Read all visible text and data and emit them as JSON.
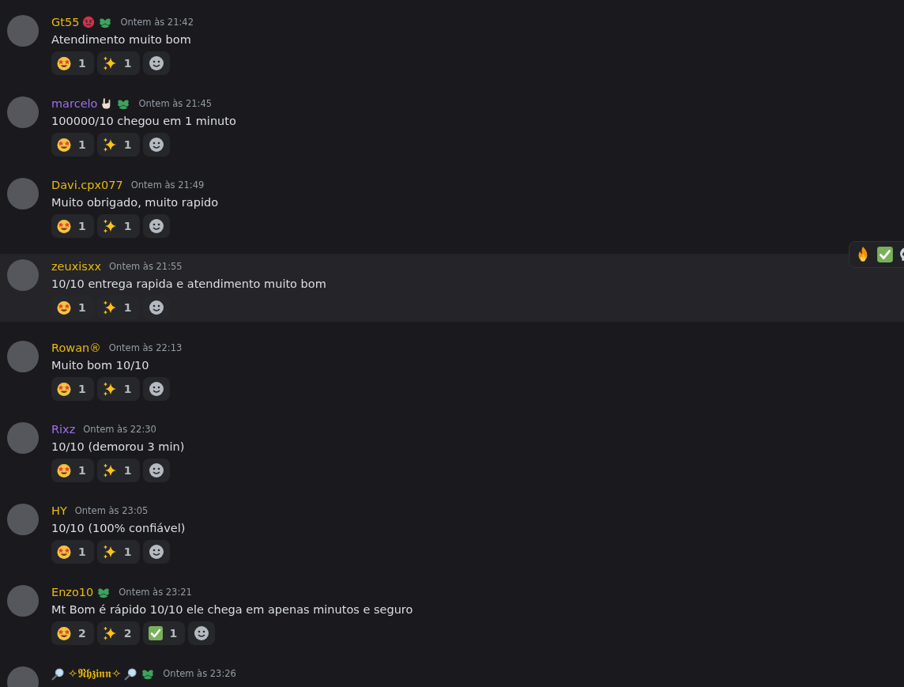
{
  "messages": [
    {
      "author": "Gt55",
      "color": "#e8b90c",
      "suffix_icons": [
        {
          "kind": "angry-face"
        },
        {
          "kind": "clover"
        }
      ],
      "time": "Ontem às 21:42",
      "text": "Atendimento muito bom",
      "highlighted": false,
      "reactions": [
        {
          "kind": "star-struck",
          "count": "1"
        },
        {
          "kind": "sparkles",
          "count": "1"
        }
      ]
    },
    {
      "author": "marcelo",
      "color": "#9f6ee8",
      "suffix_icons": [
        {
          "kind": "rock-hand"
        },
        {
          "kind": "clover"
        }
      ],
      "time": "Ontem às 21:45",
      "text": "100000/10 chegou em 1 minuto",
      "highlighted": false,
      "reactions": [
        {
          "kind": "star-struck",
          "count": "1"
        },
        {
          "kind": "sparkles",
          "count": "1"
        }
      ]
    },
    {
      "author": "Davi.cpx077",
      "color": "#e8b90c",
      "time": "Ontem às 21:49",
      "text": "Muito obrigado, muito rapido",
      "highlighted": false,
      "reactions": [
        {
          "kind": "star-struck",
          "count": "1"
        },
        {
          "kind": "sparkles",
          "count": "1"
        }
      ]
    },
    {
      "author": "zeuxisxx",
      "color": "#e8b90c",
      "time": "Ontem às 21:55",
      "text": "10/10 entrega rapida e atendimento muito bom",
      "highlighted": true,
      "reactions": [
        {
          "kind": "star-struck",
          "count": "1"
        },
        {
          "kind": "sparkles",
          "count": "1"
        }
      ]
    },
    {
      "author": "Rowan®",
      "color": "#e8b90c",
      "time": "Ontem às 22:13",
      "text": "Muito bom 10/10",
      "highlighted": false,
      "reactions": [
        {
          "kind": "star-struck",
          "count": "1"
        },
        {
          "kind": "sparkles",
          "count": "1"
        }
      ]
    },
    {
      "author": "Rixz",
      "color": "#9f6ee8",
      "time": "Ontem às 22:30",
      "text": "10/10 (demorou 3 min)",
      "highlighted": false,
      "reactions": [
        {
          "kind": "star-struck",
          "count": "1"
        },
        {
          "kind": "sparkles",
          "count": "1"
        }
      ]
    },
    {
      "author": "HY",
      "color": "#e8b90c",
      "time": "Ontem às 23:05",
      "text": "10/10 (100% confiável)",
      "highlighted": false,
      "reactions": [
        {
          "kind": "star-struck",
          "count": "1"
        },
        {
          "kind": "sparkles",
          "count": "1"
        }
      ]
    },
    {
      "author": "Enzo10",
      "color": "#e8b90c",
      "suffix_icons": [
        {
          "kind": "clover"
        }
      ],
      "time": "Ontem às 23:21",
      "text": "Mt Bom é rápido 10/10 ele chega em apenas minutos e seguro",
      "highlighted": false,
      "reactions": [
        {
          "kind": "star-struck",
          "count": "2"
        },
        {
          "kind": "sparkles",
          "count": "2"
        },
        {
          "kind": "check",
          "count": "1"
        }
      ]
    },
    {
      "author": "✧𝕹𝖍𝖟𝖎𝖓𝖓✧",
      "color": "#e8b90c",
      "prefix_icons": [
        {
          "kind": "magnifier"
        }
      ],
      "suffix_icons": [
        {
          "kind": "magnifier"
        },
        {
          "kind": "clover"
        }
      ],
      "time": "Ontem às 23:26",
      "highlighted": false
    }
  ],
  "hover_toolbar": [
    {
      "kind": "fire"
    },
    {
      "kind": "check"
    },
    {
      "kind": "skull"
    }
  ]
}
